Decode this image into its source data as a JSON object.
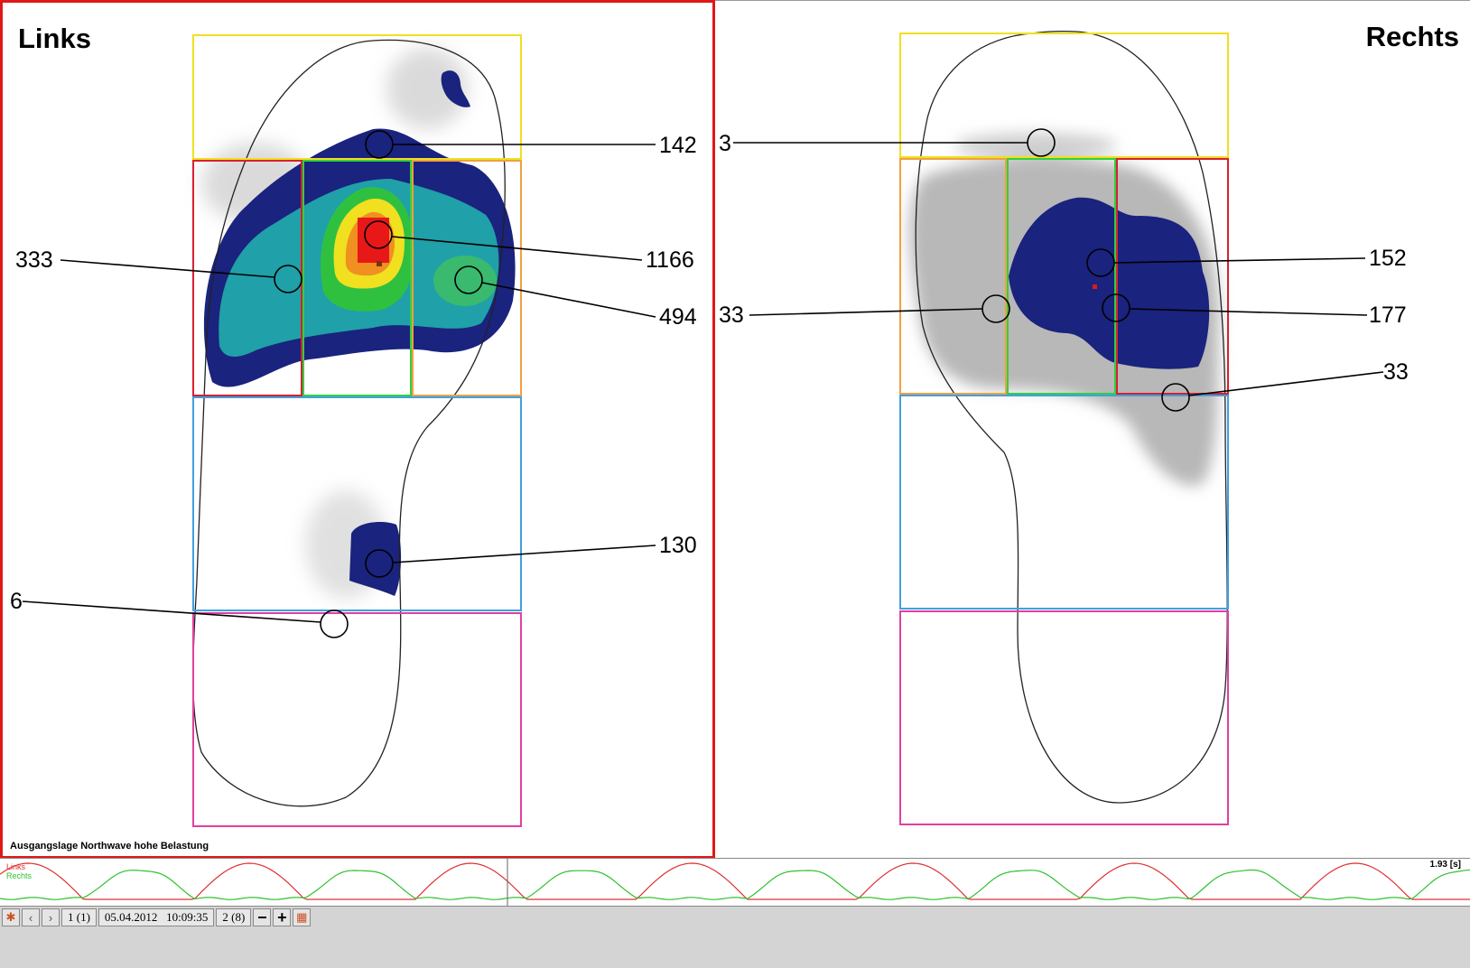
{
  "left": {
    "title": "Links",
    "caption": "Ausgangslage Northwave hohe Belastung",
    "values": {
      "toe": "142",
      "mt_medial": "1166",
      "mt_lateral_left": "333",
      "mt_lateral_right": "494",
      "midfoot": "130",
      "heel": "6"
    }
  },
  "right": {
    "title": "Rechts",
    "values": {
      "toe": "3",
      "mt_left": "33",
      "mt_center": "152",
      "mt_right": "177",
      "mt_lateral": "33"
    }
  },
  "timeline": {
    "legend_links": "Links",
    "legend_rechts": "Rechts",
    "time_readout": "1.93 [s]",
    "colors": {
      "links": "#e03030",
      "rechts": "#30c030"
    }
  },
  "toolbar": {
    "frame": "1 (1)",
    "date": "05.04.2012",
    "time": "10:09:35",
    "step": "2 (8)",
    "icons": [
      "logo-icon",
      "prev-icon",
      "next-icon",
      "zoom-out-icon",
      "zoom-in-icon",
      "export-icon"
    ]
  },
  "colors": {
    "accent_border": "#e01818",
    "zone_toe": "#f0e020",
    "zone_red": "#d82030",
    "zone_green": "#30d040",
    "zone_orange": "#f0a040",
    "zone_blue": "#40a0e0",
    "zone_pink": "#e040a0"
  }
}
